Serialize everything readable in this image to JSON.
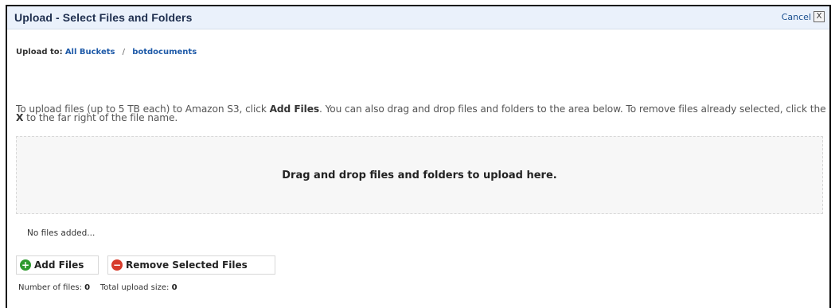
{
  "dialog": {
    "title": "Upload - Select Files and Folders",
    "cancel_label": "Cancel",
    "close_glyph": "X"
  },
  "breadcrumb": {
    "label": "Upload to:",
    "items": [
      "All Buckets",
      "botdocuments"
    ],
    "separator": "/"
  },
  "instructions": {
    "part1": "To upload files (up to 5 TB each) to Amazon S3, click ",
    "add_files_bold": "Add Files",
    "part2": ". You can also drag and drop files and folders to the area below. To remove files already selected, click the ",
    "x_bold": "X",
    "part3": " to the far right of the file name."
  },
  "dropzone": {
    "text": "Drag and drop files and folders to upload here."
  },
  "file_list": {
    "empty_text": "No files added..."
  },
  "buttons": {
    "add_files": "Add Files",
    "remove_selected": "Remove Selected Files",
    "add_icon": "plus-circle-icon",
    "remove_icon": "minus-circle-icon"
  },
  "stats": {
    "count_label": "Number of files:",
    "count_value": "0",
    "size_label": "Total upload size:",
    "size_value": "0"
  },
  "colors": {
    "titlebar_bg": "#eaf1fb",
    "link": "#1e5aa8",
    "add_icon": "#2f9a2f",
    "remove_icon": "#d73a2a"
  }
}
